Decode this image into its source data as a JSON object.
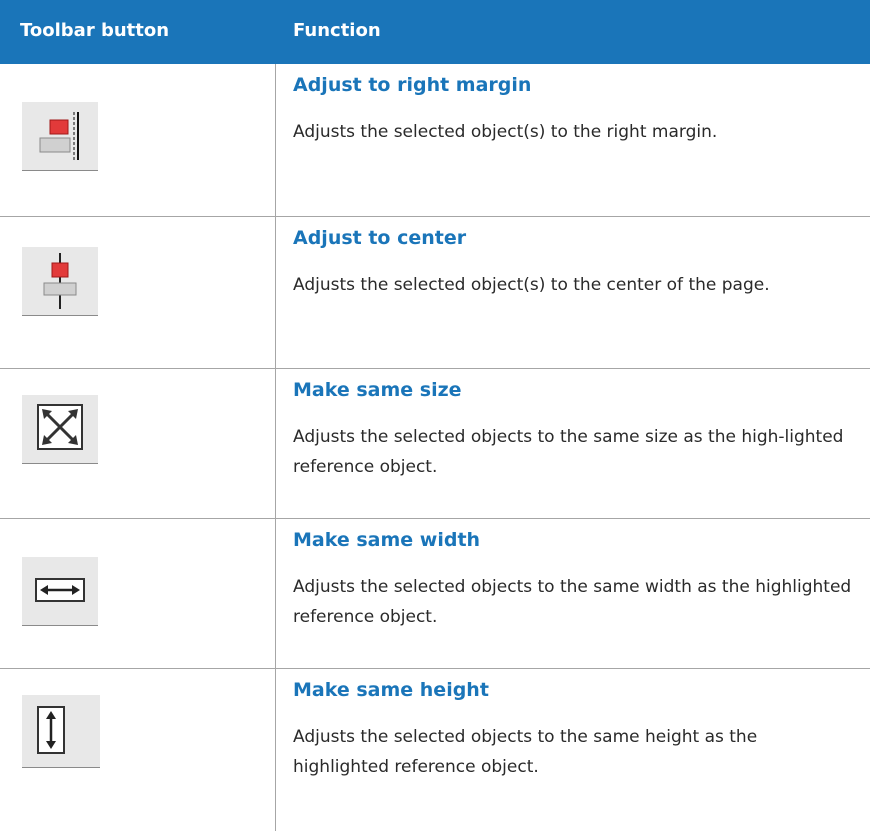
{
  "table": {
    "header": {
      "toolbar_button": "Toolbar button",
      "function": "Function"
    },
    "rows": [
      {
        "icon": "align-right-margin-icon",
        "title": "Adjust to right margin",
        "description": "Adjusts the selected object(s) to the right margin."
      },
      {
        "icon": "align-center-icon",
        "title": "Adjust to center",
        "description": "Adjusts the selected object(s) to the center of the page."
      },
      {
        "icon": "same-size-icon",
        "title": "Make same size",
        "description": "Adjusts the selected objects to the same size as the high-lighted reference object."
      },
      {
        "icon": "same-width-icon",
        "title": "Make same width",
        "description": "Adjusts the selected objects to the same width as the highlighted reference object."
      },
      {
        "icon": "same-height-icon",
        "title": "Make same height",
        "description": "Adjusts the selected objects to the same height as the highlighted reference object."
      }
    ]
  },
  "colors": {
    "header_background": "#1a75b9",
    "title_text": "#1a75b9",
    "icon_red": "#e23a3a",
    "icon_background": "#e8e8e8"
  }
}
